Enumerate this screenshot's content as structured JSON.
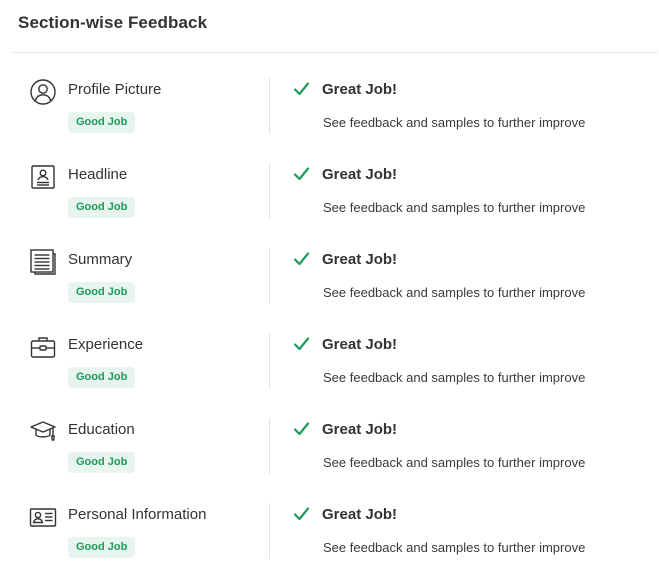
{
  "page": {
    "title": "Section-wise Feedback"
  },
  "colors": {
    "accent_green": "#1d9a5c",
    "badge_bg": "#e7f5ee",
    "icon_stroke": "#333333"
  },
  "sections": [
    {
      "name": "Profile Picture",
      "icon": "user-circle-icon",
      "badge": "Good Job",
      "status": "Great Job!",
      "hint": "See feedback and samples to further improve"
    },
    {
      "name": "Headline",
      "icon": "id-badge-icon",
      "badge": "Good Job",
      "status": "Great Job!",
      "hint": "See feedback and samples to further improve"
    },
    {
      "name": "Summary",
      "icon": "document-lines-icon",
      "badge": "Good Job",
      "status": "Great Job!",
      "hint": "See feedback and samples to further improve"
    },
    {
      "name": "Experience",
      "icon": "briefcase-icon",
      "badge": "Good Job",
      "status": "Great Job!",
      "hint": "See feedback and samples to further improve"
    },
    {
      "name": "Education",
      "icon": "graduation-cap-icon",
      "badge": "Good Job",
      "status": "Great Job!",
      "hint": "See feedback and samples to further improve"
    },
    {
      "name": "Personal Information",
      "icon": "contact-card-icon",
      "badge": "Good Job",
      "status": "Great Job!",
      "hint": "See feedback and samples to further improve"
    }
  ]
}
